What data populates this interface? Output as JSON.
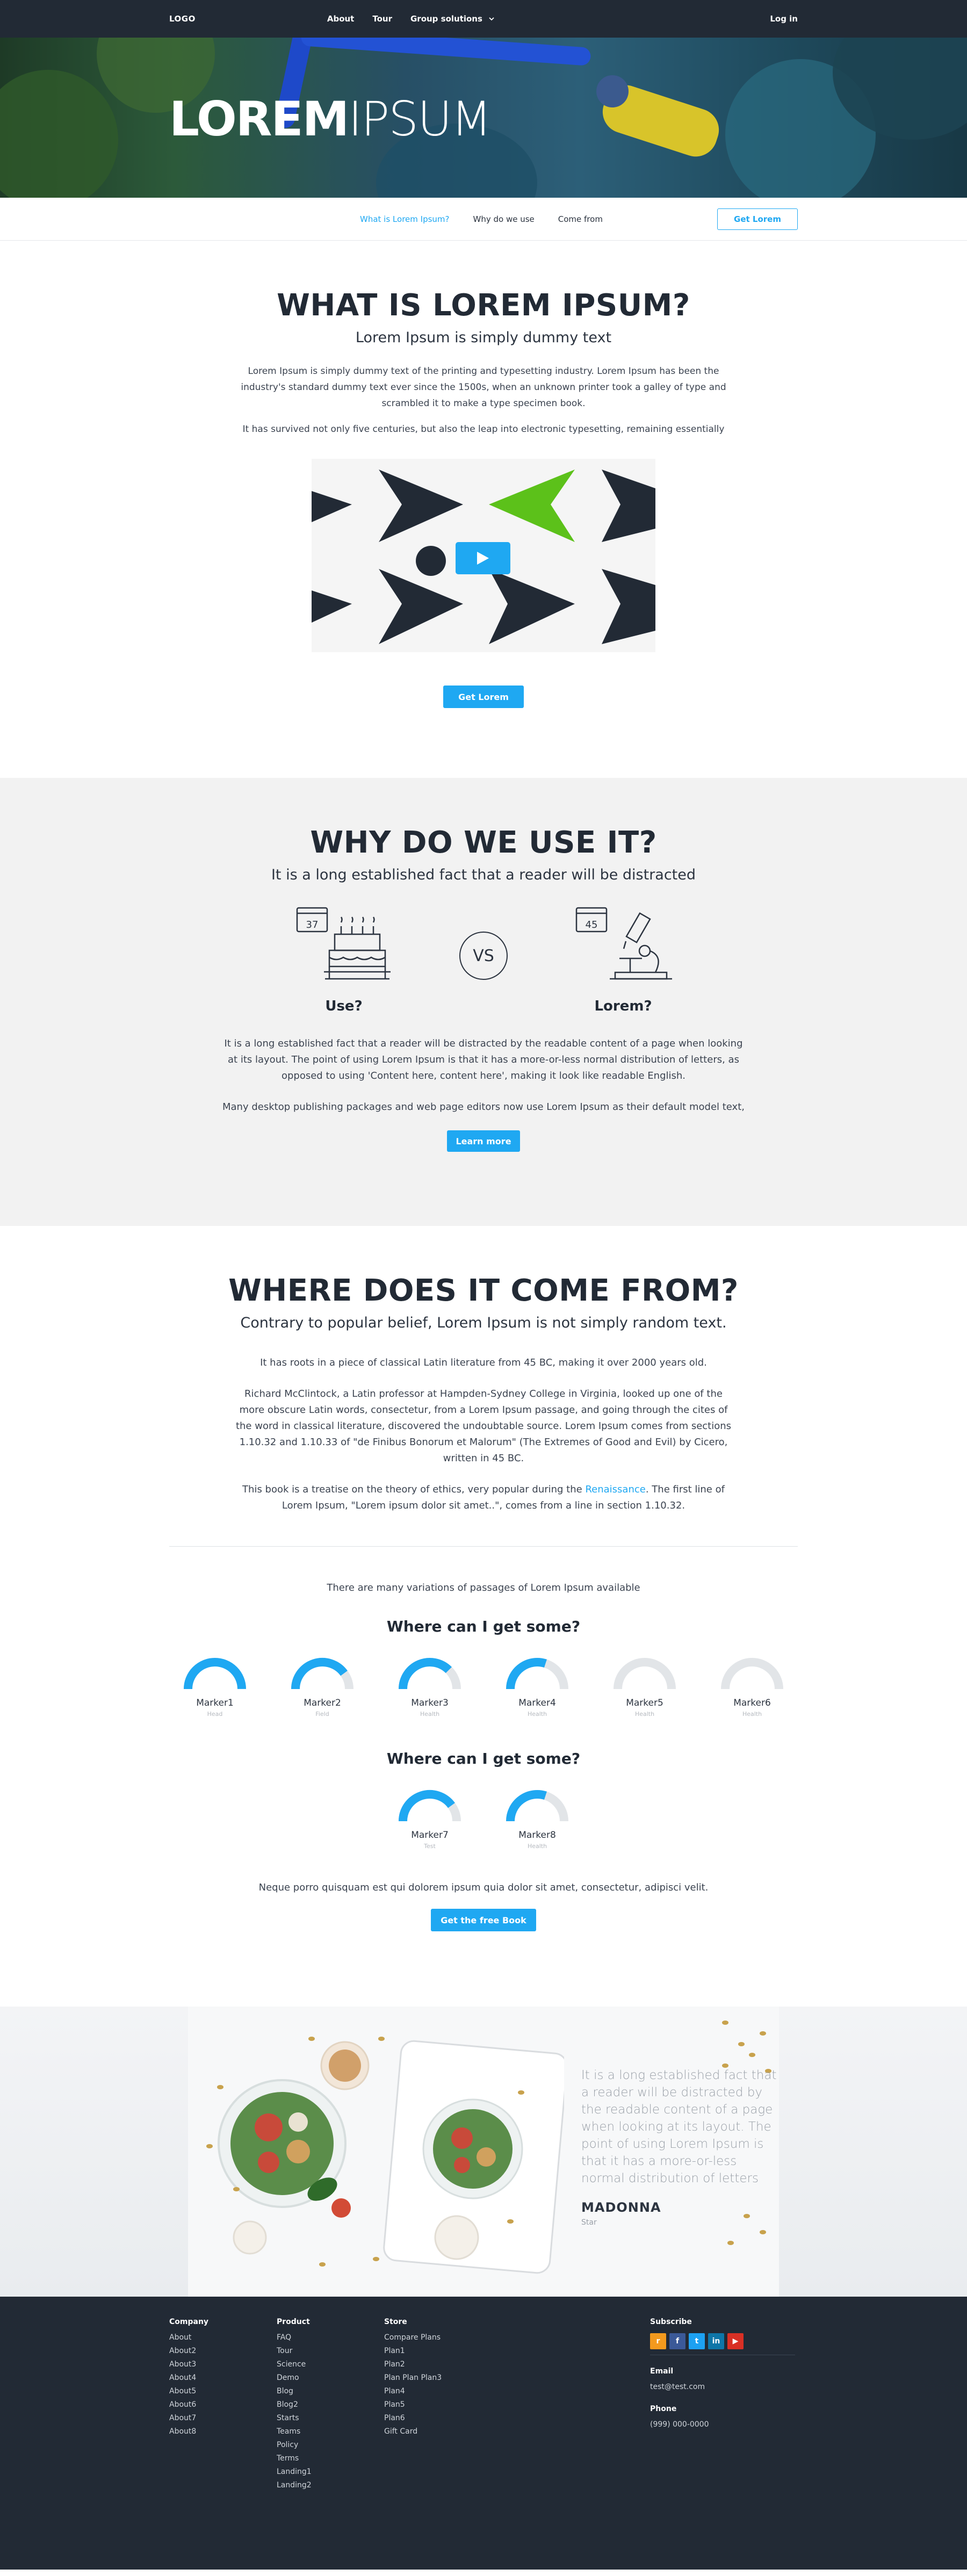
{
  "nav": {
    "logo": "LOGO",
    "items": [
      "About",
      "Tour",
      "Group solutions"
    ],
    "login": "Log in"
  },
  "hero": {
    "title_bold": "LOREM",
    "title_light": "IPSUM"
  },
  "subnav": {
    "items": [
      "What is Lorem Ipsum?",
      "Why do we use",
      "Come from"
    ],
    "button": "Get Lorem"
  },
  "section1": {
    "title": "WHAT IS LOREM IPSUM?",
    "subtitle": "Lorem Ipsum is simply dummy text",
    "para1": "Lorem Ipsum is simply dummy text of the printing and typesetting industry. Lorem Ipsum has been the industry's standard dummy text ever since the 1500s, when an unknown printer took a galley of type and scrambled it to make a type specimen book.",
    "para2": "It has survived not only five centuries, but also the leap into electronic typesetting, remaining essentially",
    "button": "Get Lorem"
  },
  "section2": {
    "title": "WHY DO WE USE IT?",
    "subtitle": "It is a long established fact that a reader will be distracted",
    "left_label": "Use?",
    "left_calendar": "37",
    "vs": "VS",
    "right_label": "Lorem?",
    "right_calendar": "45",
    "para1": "It is a long established fact that a reader will be distracted by the readable content of a page when looking at its layout. The point of using Lorem Ipsum is that it has a more-or-less normal distribution of letters, as opposed to using 'Content here, content here', making it look like readable English.",
    "para2": "Many desktop publishing packages and web page editors now use Lorem Ipsum as their default model text,",
    "button": "Learn more"
  },
  "section3": {
    "title": "WHERE DOES IT COME FROM?",
    "subtitle": "Contrary to popular belief, Lorem Ipsum is not simply random text.",
    "para1": "It has roots in a piece of classical Latin literature from 45 BC, making it over 2000 years old.",
    "para2": "Richard McClintock, a Latin professor at Hampden-Sydney College in Virginia, looked up one of the more obscure Latin words, consectetur, from a Lorem Ipsum passage, and going through the cites of the word in classical literature, discovered the undoubtable source. Lorem Ipsum comes from sections 1.10.32 and 1.10.33 of \"de Finibus Bonorum et Malorum\" (The Extremes of Good and Evil) by Cicero, written in 45 BC.",
    "para3_before": "This book is a treatise on the theory of ethics, very popular during the ",
    "para3_link": "Renaissance",
    "para3_after": ". The first line of Lorem Ipsum, \"Lorem ipsum dolor sit amet..\", comes from a line in section 1.10.32.",
    "variations": "There are many variations of passages of Lorem Ipsum available",
    "where1": "Where can I get some?",
    "where2": "Where can I get some?",
    "markers_row1": [
      {
        "label": "Marker1",
        "sub": "Head",
        "value": 1.0
      },
      {
        "label": "Marker2",
        "sub": "Field",
        "value": 0.8
      },
      {
        "label": "Marker3",
        "sub": "Health",
        "value": 0.75
      },
      {
        "label": "Marker4",
        "sub": "Health",
        "value": 0.6
      },
      {
        "label": "Marker5",
        "sub": "Health",
        "value": 0.0
      },
      {
        "label": "Marker6",
        "sub": "Health",
        "value": 0.0
      }
    ],
    "markers_row2": [
      {
        "label": "Marker7",
        "sub": "Test",
        "value": 0.8
      },
      {
        "label": "Marker8",
        "sub": "Health",
        "value": 0.6
      }
    ],
    "closing": "Neque porro quisquam est qui dolorem ipsum quia dolor sit amet, consectetur, adipisci velit.",
    "button": "Get the free Book"
  },
  "testimonial": {
    "quote": "It is a long established fact that a reader will be distracted by the readable content of a page when looking at its layout. The point of using Lorem Ipsum is that it has a more-or-less normal distribution of letters",
    "name": "MADONNA",
    "role": "Star"
  },
  "footer": {
    "company": {
      "title": "Company",
      "links": [
        "About",
        "About2",
        "About3",
        "About4",
        "About5",
        "About6",
        "About7",
        "About8"
      ]
    },
    "product": {
      "title": "Product",
      "links": [
        "FAQ",
        "Tour",
        "Science",
        "Demo",
        "Blog",
        "Blog2",
        "Starts",
        "Teams",
        "Policy",
        "Terms",
        "Landing1",
        "Landing2"
      ]
    },
    "store": {
      "title": "Store",
      "links": [
        "Compare Plans",
        "Plan1",
        "Plan2",
        "Plan Plan Plan3",
        "Plan4",
        "Plan5",
        "Plan6",
        "Gift Card"
      ]
    },
    "subscribe": {
      "title": "Subscribe",
      "email_title": "Email",
      "email": "test@test.com",
      "phone_title": "Phone",
      "phone": "(999) 000-0000"
    },
    "social": [
      {
        "icon": "rss-icon",
        "glyph": "r",
        "color": "#f39a1e"
      },
      {
        "icon": "facebook-icon",
        "glyph": "f",
        "color": "#3b5998"
      },
      {
        "icon": "twitter-icon",
        "glyph": "t",
        "color": "#1da1f2"
      },
      {
        "icon": "linkedin-icon",
        "glyph": "in",
        "color": "#0e76a8"
      },
      {
        "icon": "youtube-icon",
        "glyph": "▶",
        "color": "#d93025"
      }
    ]
  },
  "colors": {
    "accent": "#1fa8f2",
    "dark": "#222a35",
    "green": "#5cc11a"
  }
}
